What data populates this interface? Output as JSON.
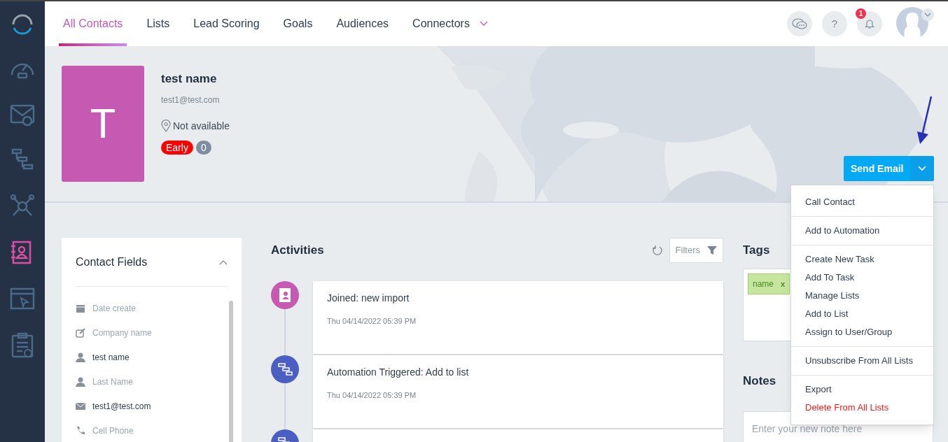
{
  "sidebar": {
    "items": [
      {
        "kind": "dashboard",
        "selected": false
      },
      {
        "kind": "email",
        "selected": false
      },
      {
        "kind": "flow",
        "selected": false
      },
      {
        "kind": "network",
        "selected": false
      },
      {
        "kind": "contacts",
        "selected": true
      },
      {
        "kind": "browser",
        "selected": false
      },
      {
        "kind": "clipboard",
        "selected": false
      }
    ]
  },
  "tabs": [
    {
      "label": "All Contacts",
      "selected": true
    },
    {
      "label": "Lists",
      "selected": false
    },
    {
      "label": "Lead Scoring",
      "selected": false
    },
    {
      "label": "Goals",
      "selected": false
    },
    {
      "label": "Audiences",
      "selected": false
    },
    {
      "label": "Connectors",
      "selected": false,
      "dropdown": true
    }
  ],
  "header": {
    "help": "?",
    "notifications": "1"
  },
  "contact": {
    "initial": "T",
    "name": "test name",
    "email": "test1@test.com",
    "location": "Not available",
    "stage": "Early",
    "score": "0"
  },
  "send_button": {
    "label": "Send Email"
  },
  "menu": [
    [
      {
        "label": "Call Contact",
        "danger": false
      }
    ],
    [
      {
        "label": "Add to Automation",
        "danger": false
      }
    ],
    [
      {
        "label": "Create New Task",
        "danger": false
      },
      {
        "label": "Add To Task",
        "danger": false
      },
      {
        "label": "Manage Lists",
        "danger": false
      },
      {
        "label": "Add to List",
        "danger": false
      },
      {
        "label": "Assign to User/Group",
        "danger": false
      }
    ],
    [
      {
        "label": "Unsubscribe From All Lists",
        "danger": false
      }
    ],
    [
      {
        "label": "Export",
        "danger": false
      },
      {
        "label": "Delete From All Lists",
        "danger": true
      }
    ]
  ],
  "contact_fields": {
    "title": "Contact Fields",
    "fields": [
      {
        "kind": "calendar",
        "placeholder": "Date create"
      },
      {
        "kind": "edit",
        "placeholder": "Company name"
      },
      {
        "kind": "person",
        "value": "test name"
      },
      {
        "kind": "person",
        "placeholder": "Last Name"
      },
      {
        "kind": "mail",
        "value": "test1@test.com"
      },
      {
        "kind": "phone",
        "placeholder": "Cell Phone"
      }
    ]
  },
  "activities": {
    "title": "Activities",
    "filter": "Filters",
    "items": [
      {
        "kind": "contact",
        "title": "Joined: new import",
        "time": "Thu 04/14/2022 05:39 PM"
      },
      {
        "kind": "automation",
        "title": "Automation Triggered: Add to list",
        "time": "Thu 04/14/2022 05:39 PM"
      },
      {
        "kind": "automation"
      }
    ]
  },
  "tags": {
    "title": "Tags",
    "items": [
      {
        "label": "name",
        "remove": "x"
      }
    ]
  },
  "notes": {
    "title": "Notes",
    "placeholder": "Enter your new note here"
  }
}
